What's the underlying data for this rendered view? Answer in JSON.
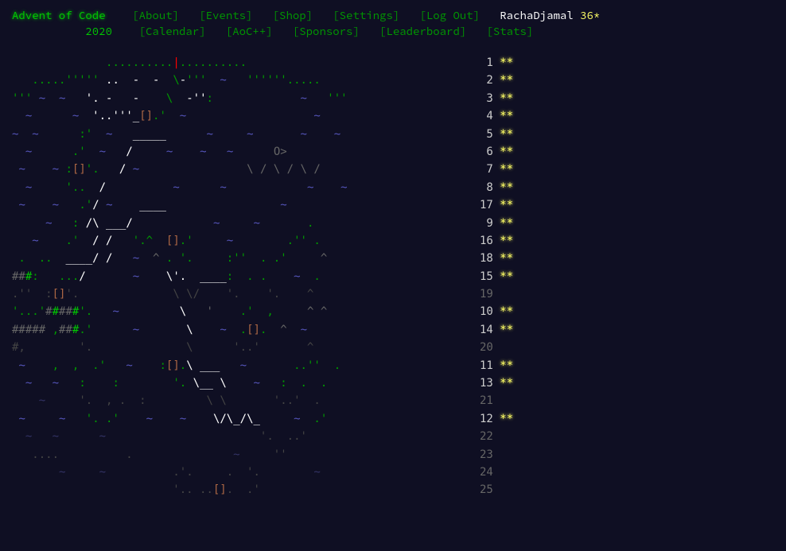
{
  "header": {
    "title": "Advent of Code",
    "nav1": [
      {
        "label": "[About]"
      },
      {
        "label": "[Events]"
      },
      {
        "label": "[Shop]"
      },
      {
        "label": "[Settings]"
      },
      {
        "label": "[Log Out]"
      }
    ],
    "user": "RachaDjamal",
    "star_count": "36*",
    "year": "2020",
    "nav2": [
      {
        "label": "[Calendar]"
      },
      {
        "label": "[AoC++]"
      },
      {
        "label": "[Sponsors]"
      },
      {
        "label": "[Leaderboard]"
      },
      {
        "label": "[Stats]"
      }
    ]
  },
  "calendar": {
    "rows": [
      {
        "day": "1",
        "stars": 2
      },
      {
        "day": "2",
        "stars": 2
      },
      {
        "day": "3",
        "stars": 2
      },
      {
        "day": "4",
        "stars": 2
      },
      {
        "day": "5",
        "stars": 2
      },
      {
        "day": "6",
        "stars": 2
      },
      {
        "day": "7",
        "stars": 2
      },
      {
        "day": "8",
        "stars": 2
      },
      {
        "day": "17",
        "stars": 2
      },
      {
        "day": "9",
        "stars": 2
      },
      {
        "day": "16",
        "stars": 2
      },
      {
        "day": "18",
        "stars": 2
      },
      {
        "day": "15",
        "stars": 2
      },
      {
        "day": "19",
        "stars": 0
      },
      {
        "day": "10",
        "stars": 2
      },
      {
        "day": "14",
        "stars": 2
      },
      {
        "day": "20",
        "stars": 0
      },
      {
        "day": "11",
        "stars": 2
      },
      {
        "day": "13",
        "stars": 2
      },
      {
        "day": "21",
        "stars": 0
      },
      {
        "day": "12",
        "stars": 2
      },
      {
        "day": "22",
        "stars": 0
      },
      {
        "day": "23",
        "stars": 0
      },
      {
        "day": "24",
        "stars": 0
      },
      {
        "day": "25",
        "stars": 0
      }
    ]
  },
  "colors": {
    "background": "#0f0f23",
    "green": "#00cc00",
    "link": "#009900",
    "star": "#ffff66",
    "wave": "#5555bb",
    "land": "#ffffff",
    "dim": "#666666"
  }
}
